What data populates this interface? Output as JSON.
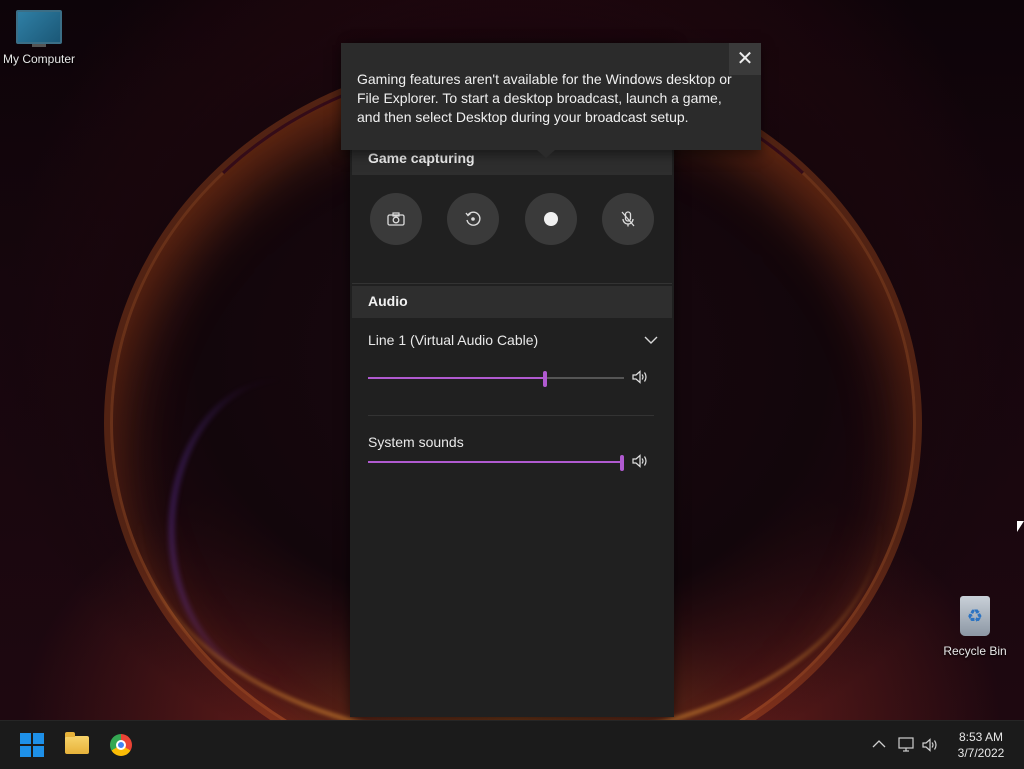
{
  "desktop": {
    "icons": [
      {
        "label": "My Computer"
      },
      {
        "label": "Recycle Bin"
      }
    ]
  },
  "gamebar": {
    "game_capturing": {
      "title": "Game capturing",
      "buttons": [
        {
          "icon": "camera-icon"
        },
        {
          "icon": "replay-icon"
        },
        {
          "icon": "record-icon"
        },
        {
          "icon": "mic-off-icon"
        }
      ]
    },
    "audio": {
      "title": "Audio",
      "device": "Line 1 (Virtual Audio Cable)",
      "device_volume": 0.69,
      "system_sounds_label": "System sounds",
      "system_volume": 1.0,
      "accent_color": "#b05ad0"
    }
  },
  "tooltip": {
    "message": "Gaming features aren't available for the Windows desktop or File Explorer. To start a desktop broadcast, launch a game, and then select Desktop during your broadcast setup.",
    "close_glyph": "✕"
  },
  "taskbar": {
    "apps": [
      {
        "name": "start-button"
      },
      {
        "name": "file-explorer"
      },
      {
        "name": "chrome"
      }
    ],
    "time": "8:53 AM",
    "date": "3/7/2022"
  }
}
